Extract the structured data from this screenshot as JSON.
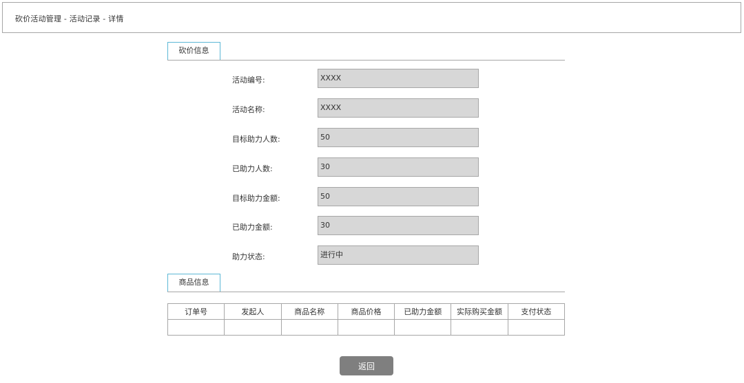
{
  "header": {
    "breadcrumb": "砍价活动管理 - 活动记录 - 详情"
  },
  "bargain_section": {
    "tab_label": "砍价信息",
    "fields": [
      {
        "label": "活动编号:",
        "value": "XXXX"
      },
      {
        "label": "活动名称:",
        "value": "XXXX"
      },
      {
        "label": "目标助力人数:",
        "value": "50"
      },
      {
        "label": "已助力人数:",
        "value": "30"
      },
      {
        "label": "目标助力金额:",
        "value": "50"
      },
      {
        "label": "已助力金额:",
        "value": "30"
      },
      {
        "label": "助力状态:",
        "value": "进行中"
      }
    ]
  },
  "goods_section": {
    "tab_label": "商品信息",
    "columns": [
      "订单号",
      "发起人",
      "商品名称",
      "商品价格",
      "已助力金额",
      "实际购买金额",
      "支付状态"
    ],
    "rows": [
      [
        "",
        "",
        "",
        "",
        "",
        "",
        ""
      ]
    ]
  },
  "footer": {
    "return_label": "返回"
  }
}
